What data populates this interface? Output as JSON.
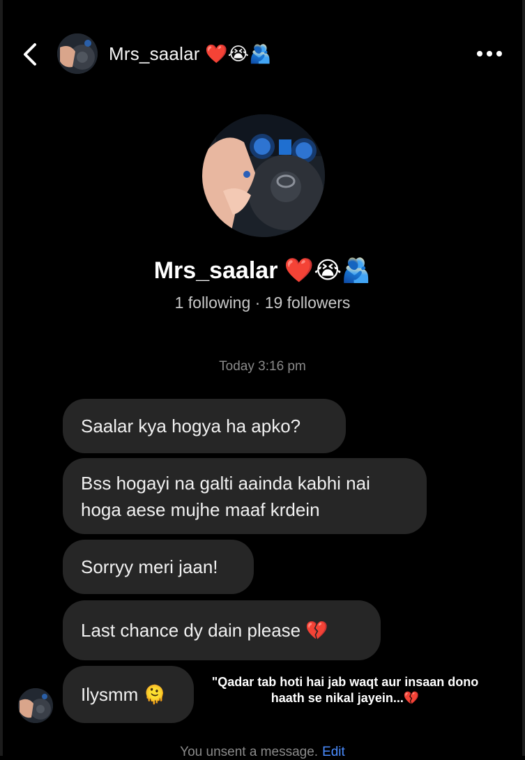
{
  "header": {
    "display_name": "Mrs_saalar ❤️😭🫂",
    "back_icon": "chevron-left-icon",
    "more_icon": "more-horizontal-icon"
  },
  "profile": {
    "name": "Mrs_saalar ❤️😭🫂",
    "stats": "1 following · 19 followers"
  },
  "thread": {
    "timestamp": "Today 3:16 pm",
    "messages": [
      {
        "text": "Saalar kya hogya ha apko?"
      },
      {
        "text": "Bss hogayi na galti aainda kabhi nai hoga aese mujhe maaf krdein"
      },
      {
        "text": "Sorryy meri jaan!"
      },
      {
        "text": "Last chance dy dain please 💔"
      },
      {
        "text": "Ilysmm 🫠"
      }
    ],
    "footer_note": "You unsent a message.",
    "footer_action": "Edit"
  },
  "overlay_quote": "\"Qadar tab hoti hai jab waqt aur insaan dono haath se nikal jayein...💔",
  "colors": {
    "background": "#000000",
    "bubble": "#262626",
    "link": "#4a8cff",
    "muted": "#8a8a8a"
  }
}
